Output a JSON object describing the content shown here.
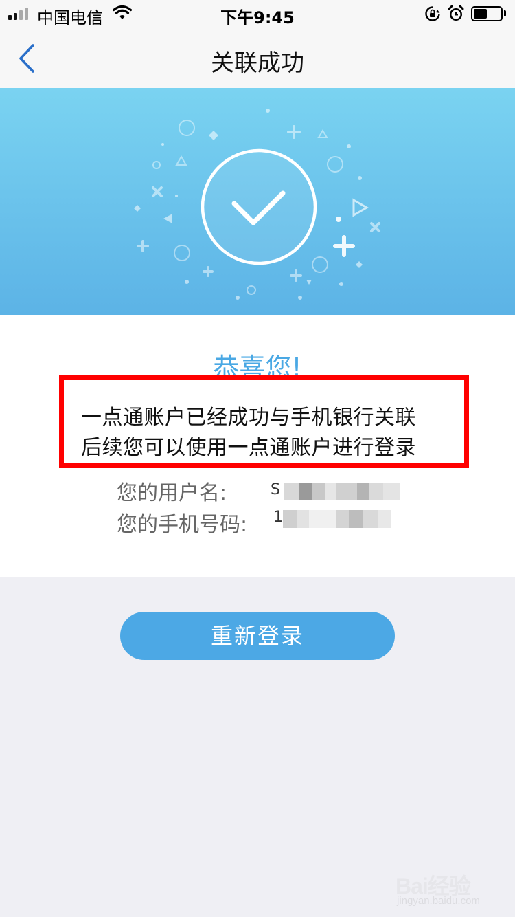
{
  "status_bar": {
    "carrier": "中国电信",
    "time": "下午9:45",
    "battery_level": 0.5
  },
  "nav": {
    "title": "关联成功",
    "back_icon": "chevron-left-icon"
  },
  "banner": {
    "icon": "check-circle-icon",
    "colors": {
      "top": "#7ad3f1",
      "bottom": "#5cb3e6"
    }
  },
  "content": {
    "congrats": "恭喜您!",
    "message_line1": "一点通账户已经成功与手机银行关联",
    "message_line2": "后续您可以使用一点通账户进行登录",
    "username_label": "您的用户名:",
    "username_visible_prefix": "S",
    "phone_label": "您的手机号码:",
    "phone_visible_prefix": "1"
  },
  "button": {
    "relogin_label": "重新登录"
  },
  "watermark": {
    "brand": "Bai经验",
    "url": "jingyan.baidu.com"
  },
  "colors": {
    "accent": "#4ca8e5",
    "highlight_border": "#ff0000",
    "page_bg": "#efeff4"
  }
}
